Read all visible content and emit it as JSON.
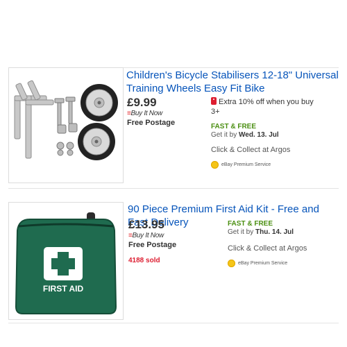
{
  "listings": [
    {
      "title": "Children's Bicycle Stabilisers 12-18\" Universal Training Wheels Easy Fit Bike",
      "price": "£9.99",
      "buy_it_now": "Buy It Now",
      "postage": "Free Postage",
      "sold": "",
      "offer": "Extra 10% off when you buy 3+",
      "fast_free": "FAST & FREE",
      "get_it_prefix": "Get it by",
      "get_it_date": "Wed. 13. Jul",
      "click_collect": "Click & Collect at Argos",
      "premium_service": "eBay Premium Service"
    },
    {
      "title": "90 Piece Premium First Aid Kit - Free and Fast Delivery",
      "price": "£13.95",
      "buy_it_now": "Buy It Now",
      "postage": "Free Postage",
      "sold": "4188 sold",
      "offer": "",
      "fast_free": "FAST & FREE",
      "get_it_prefix": "Get it by",
      "get_it_date": "Thu. 14. Jul",
      "click_collect": "Click & Collect at Argos",
      "premium_service": "eBay Premium Service",
      "image_text": "FIRST AID"
    }
  ],
  "colors": {
    "link": "#0654ba",
    "buy_it_now": "#e43137",
    "fast_free": "#4b8f12",
    "sold": "#dd1e31",
    "first_aid_bag": "#1f6b4f"
  }
}
